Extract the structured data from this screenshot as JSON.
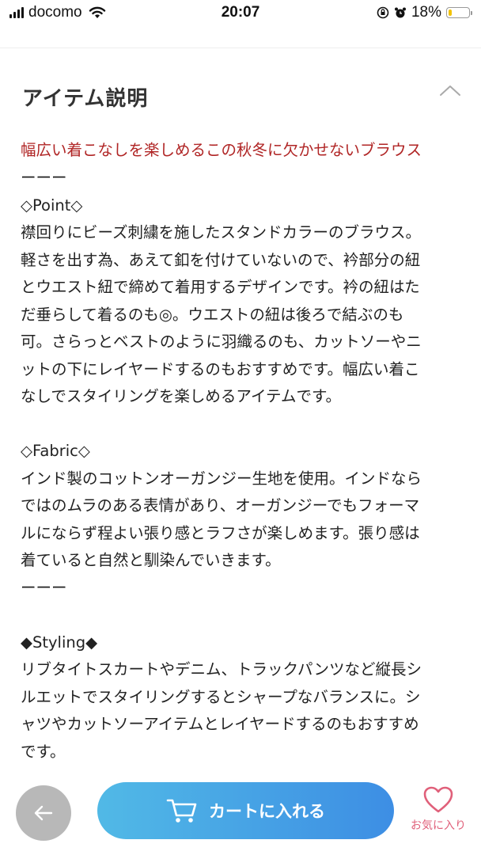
{
  "status_bar": {
    "carrier": "docomo",
    "time": "20:07",
    "battery": "18%",
    "battery_level": 0.18
  },
  "section": {
    "title": "アイテム説明",
    "collapse_icon": "chevron-up-icon"
  },
  "description": {
    "tagline": "幅広い着こなしを楽しめるこの秋冬に欠かせないブラウス",
    "lines": [
      "ーーー",
      "◇Point◇",
      "襟回りにビーズ刺繍を施したスタンドカラーのブラウス。",
      "軽さを出す為、あえて釦を付けていないので、衿部分の紐",
      "とウエスト紐で締めて着用するデザインです。衿の紐はた",
      "だ垂らして着るのも◎。ウエストの紐は後ろで結ぶのも",
      "可。さらっとベストのように羽織るのも、カットソーやニ",
      "ットの下にレイヤードするのもおすすめです。幅広い着こ",
      "なしでスタイリングを楽しめるアイテムです。",
      "",
      "◇Fabric◇",
      "インド製のコットンオーガンジー生地を使用。インドなら",
      "ではのムラのある表情があり、オーガンジーでもフォーマ",
      "ルにならず程よい張り感とラフさが楽しめます。張り感は",
      "着ていると自然と馴染んでいきます。",
      "ーーー",
      "",
      "◆Styling◆",
      "リブタイトスカートやデニム、トラックパンツなど縦長シ",
      "ルエットでスタイリングするとシャープなバランスに。シ",
      "ャツやカットソーアイテムとレイヤードするのもおすすめ",
      "です。"
    ]
  },
  "bottom_bar": {
    "back_icon": "arrow-left-icon",
    "cart_label": "カートに入れる",
    "cart_icon": "cart-icon",
    "favorite_label": "お気に入り",
    "favorite_icon": "heart-icon",
    "accent_color": "#3d8ee4",
    "favorite_color": "#e0607a"
  }
}
